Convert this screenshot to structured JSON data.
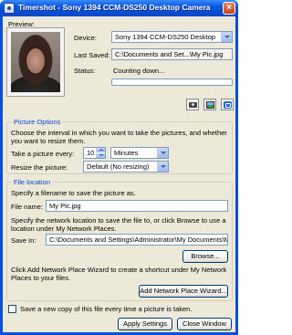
{
  "window": {
    "title": "Timershot - Sony 1394 CCM-DS250 Desktop Camera"
  },
  "preview": {
    "label": "Preview:",
    "device_label": "Device:",
    "device_value": "Sony 1394 CCM-DS250 Desktop",
    "last_saved_label": "Last Saved:",
    "last_saved_value": "C:\\Documents and Set...\\My Pic.jpg",
    "status_label": "Status:",
    "status_value": "Counting down...",
    "progress": 0
  },
  "picture_options": {
    "title": "Picture Options",
    "description": "Choose the interval in which you want to take the pictures, and whether you want to resize them.",
    "every_label": "Take a picture every:",
    "every_value": "10",
    "unit_value": "Minutes",
    "resize_label": "Resize the picture:",
    "resize_value": "Default (No resizing)"
  },
  "file_location": {
    "title": "File location",
    "filename_hint": "Specify a filename to save the picture as.",
    "filename_label": "File name:",
    "filename_value": "My Pic.jpg",
    "network_hint": "Specify the network location to save the file to, or click Browse to use a location under My Network Places.",
    "save_in_label": "Save In:",
    "save_in_value": "C:\\Documents and Settings\\Administrator\\My Documents\\My Pictures",
    "browse_label": "Browse...",
    "wizard_hint": "Click Add Network Place Wizard to create a shortcut under My Network Places to your files.",
    "wizard_label": "Add Network Place Wizard..."
  },
  "save_copy_label": "Save a new copy of this file every time a picture is taken.",
  "buttons": {
    "apply_label": "Apply Settings",
    "close_label": "Close Window"
  },
  "icons": [
    "camera-icon",
    "picture-icon",
    "network-share-icon",
    "close-icon"
  ]
}
